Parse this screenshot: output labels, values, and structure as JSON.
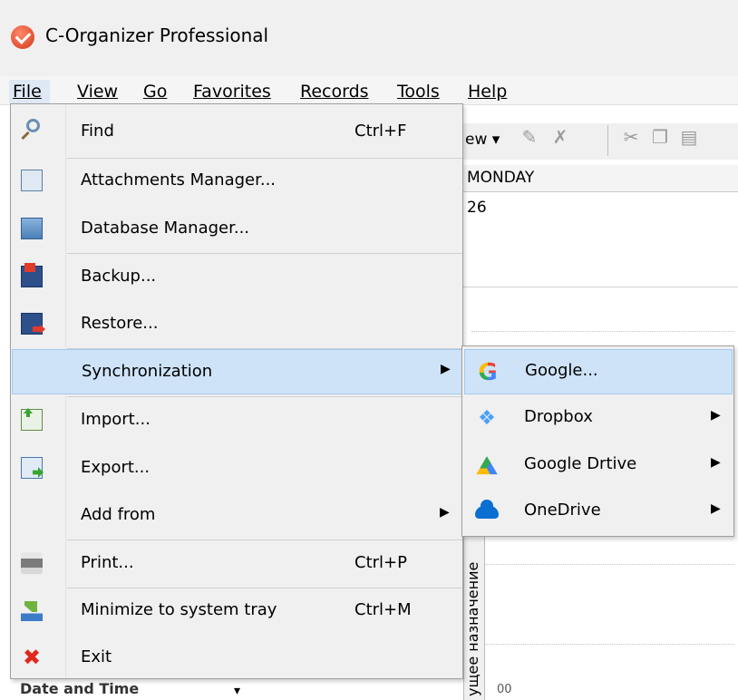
{
  "window": {
    "title": "C-Organizer Professional"
  },
  "menubar": {
    "items": [
      {
        "label": "File",
        "active": true
      },
      {
        "label": "View"
      },
      {
        "label": "Go"
      },
      {
        "label": "Favorites"
      },
      {
        "label": "Records"
      },
      {
        "label": "Tools"
      },
      {
        "label": "Help"
      }
    ]
  },
  "background": {
    "toolbar": {
      "new_label": "ew ▾"
    },
    "calendar": {
      "day": "MONDAY",
      "date": "26"
    },
    "vertical_label": "ущее назначение",
    "time_label": "00",
    "left_pane_label": "Date and Time"
  },
  "file_menu": {
    "items": [
      {
        "label": "Find",
        "shortcut": "Ctrl+F",
        "icon": "find-icon"
      },
      {
        "label": "Attachments Manager...",
        "icon": "attachments-icon"
      },
      {
        "label": "Database Manager...",
        "icon": "database-icon"
      },
      {
        "label": "Backup...",
        "icon": "backup-icon"
      },
      {
        "label": "Restore...",
        "icon": "restore-icon"
      },
      {
        "label": "Synchronization",
        "submenu": true,
        "highlighted": true
      },
      {
        "label": "Import...",
        "icon": "import-icon"
      },
      {
        "label": "Export...",
        "icon": "export-icon"
      },
      {
        "label": "Add from",
        "submenu": true
      },
      {
        "label": "Print...",
        "shortcut": "Ctrl+P",
        "icon": "print-icon"
      },
      {
        "label": "Minimize to system tray",
        "shortcut": "Ctrl+M",
        "icon": "tray-icon"
      },
      {
        "label": "Exit",
        "icon": "exit-icon"
      }
    ]
  },
  "sync_menu": {
    "items": [
      {
        "label": "Google...",
        "icon": "google-icon",
        "highlighted": true
      },
      {
        "label": "Dropbox",
        "icon": "dropbox-icon",
        "submenu": true
      },
      {
        "label": "Google Drtive",
        "icon": "google-drive-icon",
        "submenu": true
      },
      {
        "label": "OneDrive",
        "icon": "onedrive-icon",
        "submenu": true
      }
    ]
  },
  "colors": {
    "highlight": "#cfe3f8",
    "highlight_border": "#a5c8ef",
    "menu_bg": "#f0f0f0"
  }
}
